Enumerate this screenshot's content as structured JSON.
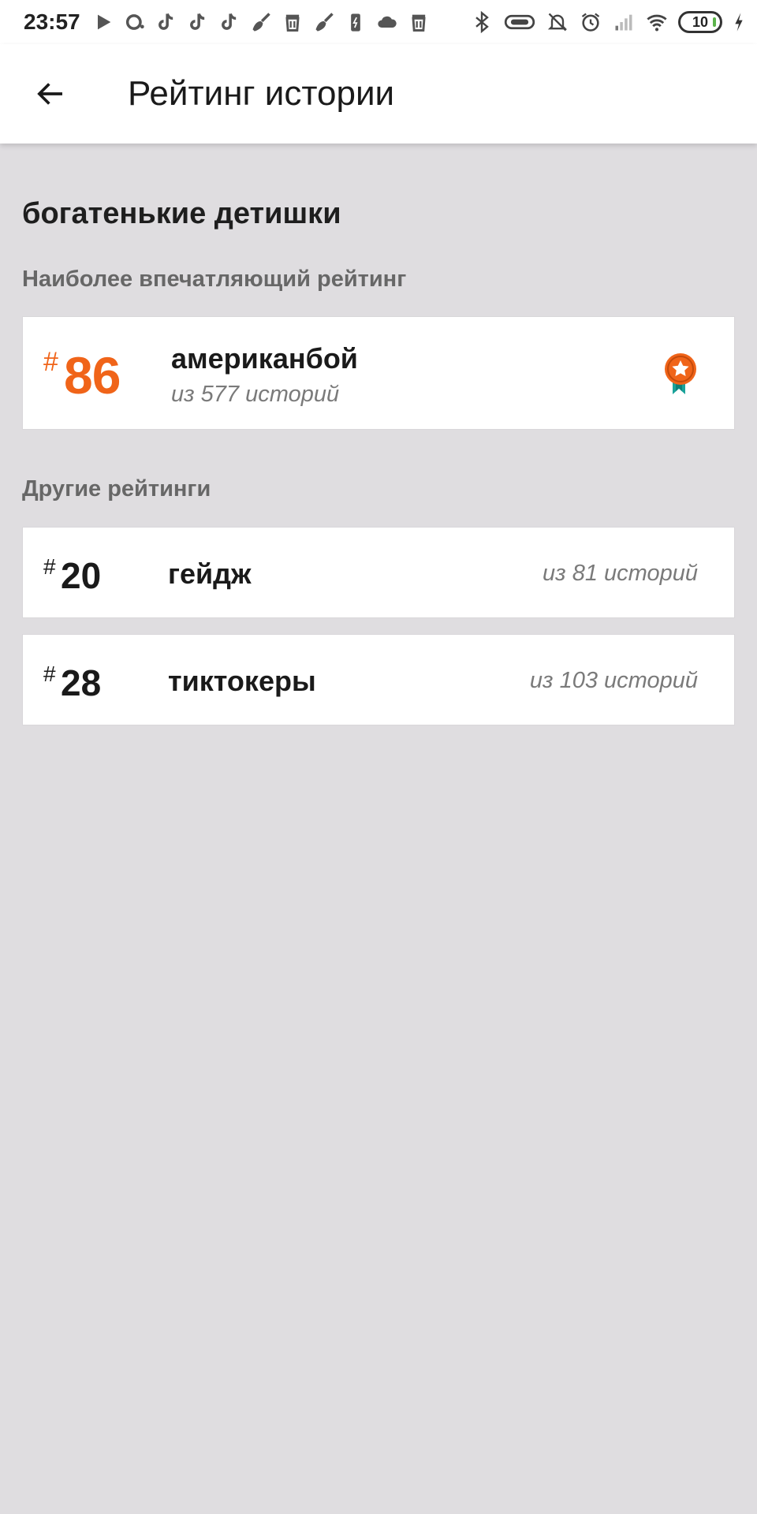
{
  "status_bar": {
    "time": "23:57",
    "battery_level": "10",
    "left_icons": [
      "play-icon",
      "notification-icon",
      "tiktok-icon",
      "tiktok-icon",
      "tiktok-icon",
      "broom-icon",
      "trash-icon",
      "broom-icon",
      "battery-saver-icon",
      "cloud-icon",
      "trash-icon"
    ],
    "right_icons": [
      "bluetooth-icon",
      "toggle-icon",
      "mute-icon",
      "alarm-icon",
      "signal-icon",
      "wifi-icon",
      "battery-icon",
      "charging-icon"
    ]
  },
  "header": {
    "title": "Рейтинг истории",
    "back_icon": "arrow-left-icon"
  },
  "story": {
    "title": "богатенькие детишки"
  },
  "best_rating": {
    "section_label": "Наиболее впечатляющий рейтинг",
    "hash": "#",
    "rank": "86",
    "category": "американбой",
    "count_text": "из 577 историй",
    "badge_icon": "award-ribbon-icon",
    "accent_color": "#f06419"
  },
  "other_ratings": {
    "section_label": "Другие рейтинги",
    "items": [
      {
        "hash": "#",
        "rank": "20",
        "category": "гейдж",
        "count_text": "из 81 историй"
      },
      {
        "hash": "#",
        "rank": "28",
        "category": "тиктокеры",
        "count_text": "из 103 историй"
      }
    ]
  }
}
